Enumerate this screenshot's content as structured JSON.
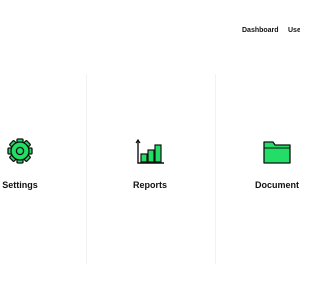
{
  "nav": {
    "links": [
      {
        "label": "Dashboard"
      },
      {
        "label": "Use"
      }
    ]
  },
  "cards": [
    {
      "label": "Settings",
      "icon": "gear-icon"
    },
    {
      "label": "Reports",
      "icon": "bar-chart-icon"
    },
    {
      "label": "Document",
      "icon": "folder-icon"
    }
  ],
  "colors": {
    "accent": "#22dd66",
    "outline": "#111111",
    "divider": "#f1f2f2"
  }
}
